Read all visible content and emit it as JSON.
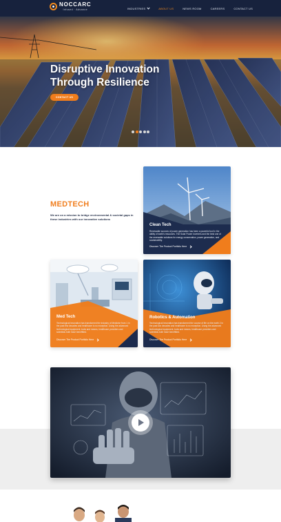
{
  "nav": {
    "brand": "NOCCARC",
    "tagline": "Infused · Advance",
    "items": [
      {
        "label": "INDUSTRIES",
        "has_dropdown": true,
        "active": false
      },
      {
        "label": "ABOUT US",
        "has_dropdown": false,
        "active": true
      },
      {
        "label": "NEWS ROOM",
        "has_dropdown": false,
        "active": false
      },
      {
        "label": "CAREERS",
        "has_dropdown": false,
        "active": false
      },
      {
        "label": "CONTACT US",
        "has_dropdown": false,
        "active": false
      }
    ]
  },
  "hero": {
    "title_line1": "Disruptive Innovation",
    "title_line2": "Through Resilience",
    "cta": "CONTACT US",
    "slides": 5,
    "active_slide": 2
  },
  "intro": {
    "title": "MEDTECH",
    "text": "We are on a mission to bridge environmental & societal gaps in these industries with our innovative solutions"
  },
  "cards": [
    {
      "title": "Clean Tech",
      "text": "Renewable sources of power generation has been a powerful tool in the ability of earth's resources. The Solar Power Inverters and the best one of the renewable solutions for energy conservation, power generation, and sustainability.",
      "link": "Discover The Product Portfolio Here"
    },
    {
      "title": "Med Tech",
      "text": "Technological innovation has transformed the industry of Medicine from 1 in the past few decades and healthcare is no exception. Using the advanced technological equipment, tools and means, healthcare providers and scientists both have benefitted.",
      "link": "Discover The Product Portfolio Here"
    },
    {
      "title": "Robotics & Automation",
      "text": "Technological innovation has transformed the course of life on the earth 2 in the past two decades and healthcare is no exception. Using the advanced technological equipment, tools and means, healthcare providers and scientists both have benefitted.",
      "link": "Discover The Product Portfolio Here"
    }
  ],
  "colors": {
    "navy": "#17223d",
    "accent": "#f07d1c",
    "card_navy": "#1c2b4d"
  },
  "icons": {
    "play": "play-icon",
    "dropdown": "chevron-down-icon",
    "arrow": "chevron-right-icon"
  }
}
